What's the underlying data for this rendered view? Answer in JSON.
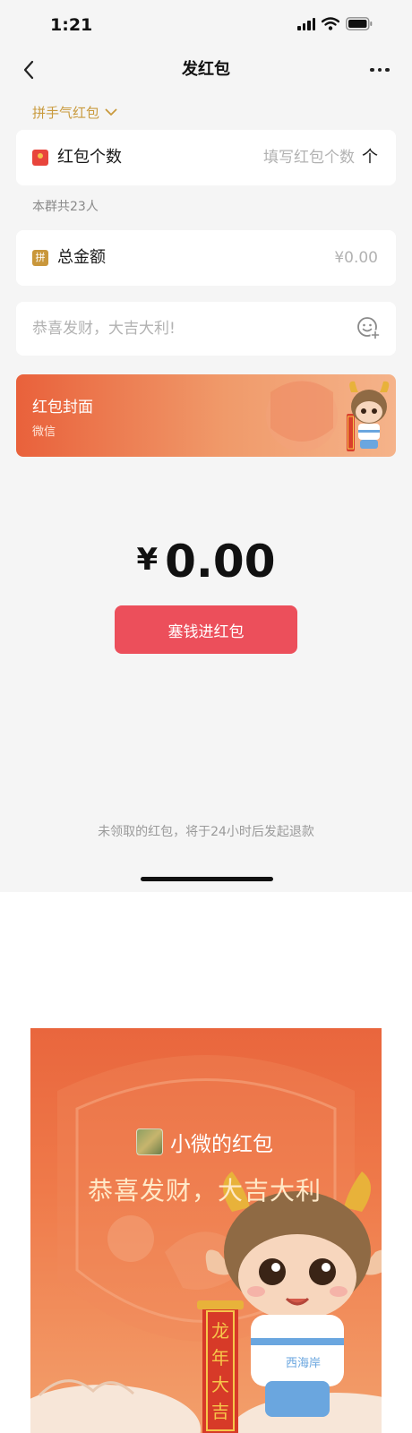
{
  "status_bar": {
    "time": "1:21"
  },
  "nav": {
    "title": "发红包"
  },
  "type_selector": {
    "label": "拼手气红包"
  },
  "count_row": {
    "label": "红包个数",
    "placeholder": "填写红包个数",
    "unit": "个"
  },
  "group_note": "本群共23人",
  "amount_row": {
    "icon_text": "拼",
    "label": "总金额",
    "placeholder": "¥0.00"
  },
  "greeting": {
    "placeholder": "恭喜发财，大吉大利!"
  },
  "cover": {
    "title": "红包封面",
    "subtitle": "微信"
  },
  "total": {
    "symbol": "¥",
    "amount": "0.00"
  },
  "submit": {
    "label": "塞钱进红包"
  },
  "refund_note": "未领取的红包，将于24小时后发起退款",
  "preview": {
    "sender": "小微的红包",
    "greeting": "恭喜发财，大吉大利",
    "banner_text": "龙年大吉",
    "shirt_text": "西海岸"
  },
  "colors": {
    "accent_red": "#ec4f5b",
    "gold": "#c99a3d",
    "cover_orange": "#e9663d",
    "background": "#f5f5f5"
  },
  "icons": {
    "back": "chevron-left-icon",
    "more": "more-dots-icon",
    "dropdown": "chevron-down-icon",
    "hongbao": "red-envelope-icon",
    "emoji": "emoji-add-icon"
  }
}
